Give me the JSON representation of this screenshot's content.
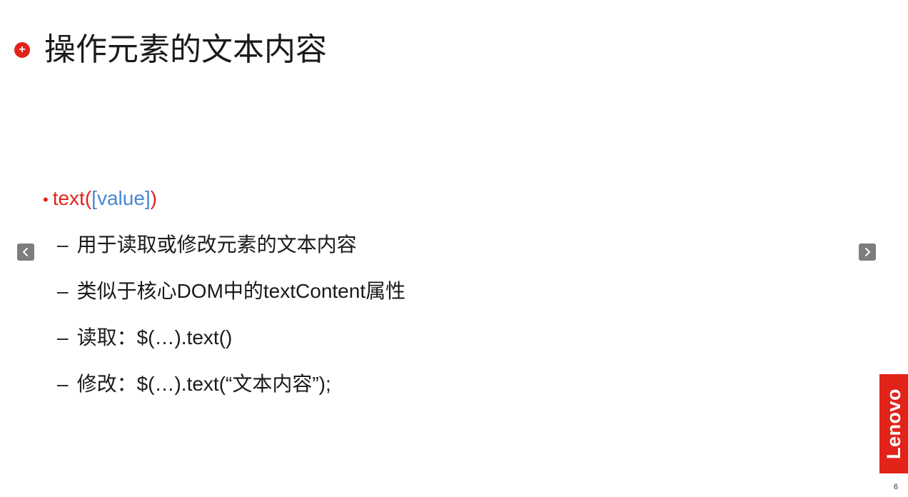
{
  "slide": {
    "title": "操作元素的文本内容",
    "bullet": {
      "method_prefix": "text(",
      "param": "[value]",
      "method_suffix": ")"
    },
    "sub_bullets": [
      "用于读取或修改元素的文本内容",
      "类似于核心DOM中的textContent属性",
      "读取：$(…).text()",
      "修改：$(…).text(“文本内容”);"
    ],
    "dash": "–",
    "bullet_dot": "•",
    "logo": "Lenovo",
    "page_number": "6"
  },
  "navigation": {
    "prev_icon": "chevron-left-icon",
    "next_icon": "chevron-right-icon"
  },
  "colors": {
    "accent": "#e2231a",
    "param_blue": "#4a86d4",
    "nav_button": "#7d7d7d"
  }
}
